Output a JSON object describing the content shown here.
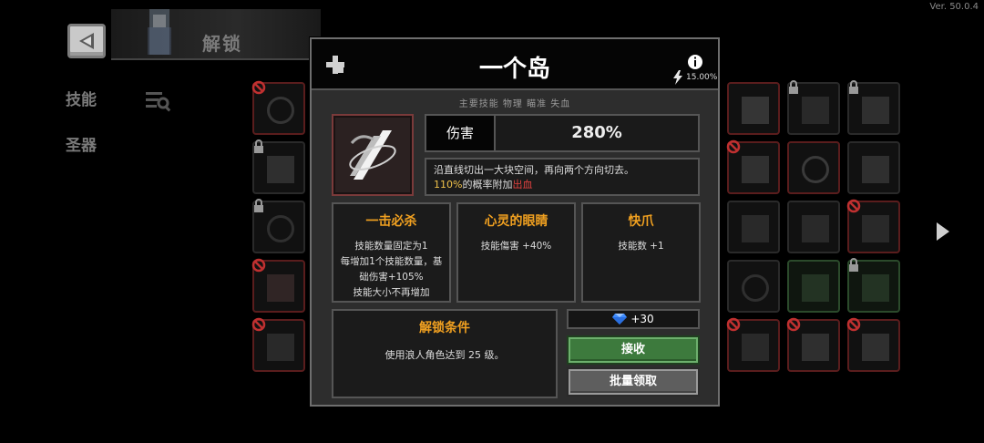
{
  "version": "Ver. 50.0.4",
  "header": {
    "title": "解锁"
  },
  "sidebar": {
    "items": [
      {
        "label": "技能"
      },
      {
        "label": "圣器"
      }
    ]
  },
  "modal": {
    "title": "一个岛",
    "crit_rate": "15.00%",
    "tags": "主要技能 物理 瞄准 失血",
    "stat": {
      "label": "伤害",
      "value": "280%"
    },
    "description": {
      "line1": "沿直线切出一大块空间，再向两个方向切去。",
      "chance": "110%",
      "chance_text": "的概率附加",
      "effect": "出血"
    },
    "traits": [
      {
        "title": "一击必杀",
        "lines": [
          "技能数量固定为1",
          "每增加1个技能数量，基",
          "础伤害+105%",
          "技能大小不再增加"
        ]
      },
      {
        "title": "心灵的眼睛",
        "lines": [
          "技能傷害 +40%"
        ]
      },
      {
        "title": "快爪",
        "lines": [
          "技能数 +1"
        ]
      }
    ],
    "unlock": {
      "title": "解锁条件",
      "condition": "使用浪人角色达到 25 级。"
    },
    "reward": {
      "icon": "diamond-gem-icon",
      "amount": "+30"
    },
    "buttons": {
      "receive": "接收",
      "bulk_claim": "批量领取"
    }
  },
  "colors": {
    "accent_orange": "#f0a020",
    "chance_yellow": "#f0c24b",
    "bleed_red": "#e0413f",
    "receive_green": "#3d7a3d"
  }
}
